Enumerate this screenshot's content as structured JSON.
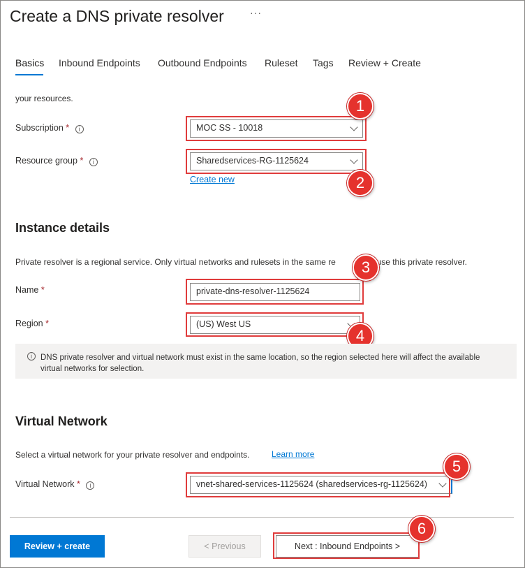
{
  "page": {
    "title": "Create a DNS private resolver",
    "more": "···"
  },
  "tabs": [
    {
      "label": "Basics",
      "active": true
    },
    {
      "label": "Inbound Endpoints"
    },
    {
      "label": "Outbound Endpoints"
    },
    {
      "label": "Ruleset"
    },
    {
      "label": "Tags"
    },
    {
      "label": "Review + Create"
    }
  ],
  "intro_text": "your resources.",
  "project": {
    "subscription_label": "Subscription",
    "subscription_value": "MOC SS - 10018",
    "resource_group_label": "Resource group",
    "resource_group_value": "Sharedservices-RG-1125624",
    "create_new": "Create new"
  },
  "instance": {
    "heading": "Instance details",
    "description": "Private resolver is a regional service. Only virtual networks and rulesets in the same re",
    "description_tail": "can use this private resolver.",
    "name_label": "Name",
    "name_value": "private-dns-resolver-1125624",
    "region_label": "Region",
    "region_value": "(US) West US",
    "notice_line1": "DNS private resolver and virtual network must exist in the same location, so the region selected here will affect the available",
    "notice_line2": "virtual networks for selection."
  },
  "vnet": {
    "heading": "Virtual Network",
    "description": "Select a virtual network for your private resolver and endpoints.",
    "learn_more": "Learn more",
    "label": "Virtual Network",
    "value": "vnet-shared-services-1125624 (sharedservices-rg-1125624)"
  },
  "footer": {
    "review_create": "Review + create",
    "previous": "< Previous",
    "next": "Next : Inbound Endpoints >"
  },
  "callouts": [
    "1",
    "2",
    "3",
    "4",
    "5",
    "6"
  ],
  "required_mark": "*",
  "info_glyph": "i",
  "colors": {
    "accent": "#0078d4",
    "callout": "#e03c3c",
    "required": "#a4262c"
  }
}
